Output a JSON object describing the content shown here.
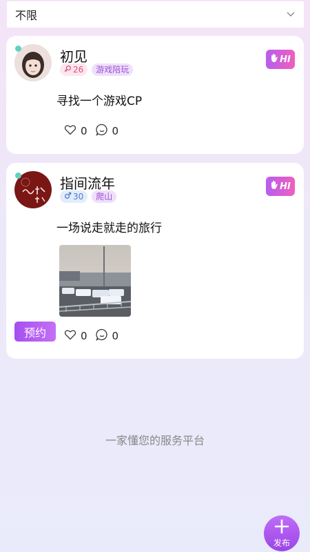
{
  "filter": {
    "label": "不限",
    "icon": "chevron-down-icon"
  },
  "posts": [
    {
      "name": "初见",
      "gender": "female",
      "age": "26",
      "tag": "游戏陪玩",
      "hi_label": "HI",
      "text": "寻找一个游戏CP",
      "likes": "0",
      "comments": "0"
    },
    {
      "name": "指间流年",
      "gender": "male",
      "age": "30",
      "tag": "爬山",
      "hi_label": "HI",
      "text": "一场说走就走的旅行",
      "likes": "0",
      "comments": "0",
      "book_label": "预约"
    }
  ],
  "slogan": "一家懂您的服务平台",
  "fab": {
    "label": "发布"
  },
  "colors": {
    "accent": "#a64ff0",
    "online": "#5ed3c0",
    "female": "#e04f7c",
    "male": "#4a7ad6"
  }
}
